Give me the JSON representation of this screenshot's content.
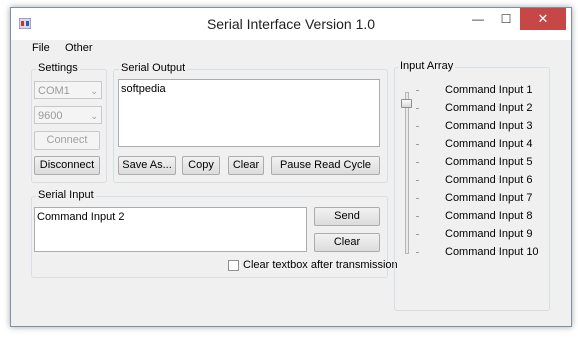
{
  "window": {
    "title": "Serial Interface Version 1.0",
    "minimize": "—",
    "maximize": "☐",
    "close": "✕"
  },
  "menu": {
    "file": "File",
    "other": "Other"
  },
  "settings": {
    "label": "Settings",
    "port": "COM1",
    "baud": "9600",
    "connect": "Connect",
    "disconnect": "Disconnect"
  },
  "serial_output": {
    "label": "Serial Output",
    "text": "softpedia",
    "save_as": "Save As...",
    "copy": "Copy",
    "clear": "Clear",
    "pause": "Pause Read Cycle"
  },
  "serial_input": {
    "label": "Serial Input",
    "text": "Command Input 2",
    "send": "Send",
    "clear": "Clear",
    "clear_after": "Clear textbox after transmission",
    "clear_after_checked": false
  },
  "input_array": {
    "label": "Input Array",
    "selected_index": 1,
    "items": [
      "Command Input 1",
      "Command Input 2",
      "Command Input 3",
      "Command Input 4",
      "Command Input 5",
      "Command Input 6",
      "Command Input 7",
      "Command Input 8",
      "Command Input 9",
      "Command Input 10"
    ]
  }
}
